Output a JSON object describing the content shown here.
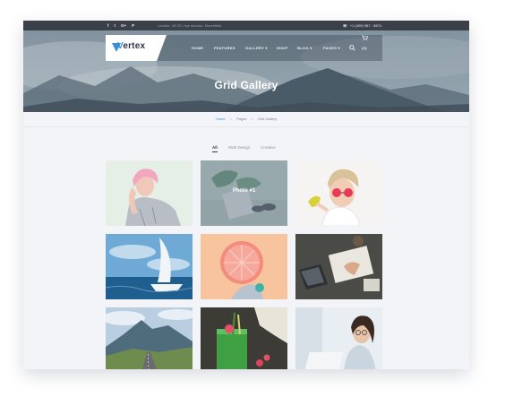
{
  "topbar": {
    "social": [
      "f",
      "t",
      "G+",
      "P"
    ],
    "address": "London, UK 53, Hye Avenue, Moorefield",
    "phone": "+1 (409) 987 - 5874"
  },
  "brand": {
    "logo_text": "ertex",
    "logo_mark": "V"
  },
  "nav": {
    "items": [
      "HOME",
      "FEATURES",
      "GALLERY",
      "SHOP",
      "BLOG",
      "PAGES"
    ],
    "cart": "(0)"
  },
  "hero": {
    "title": "Grid Gallery"
  },
  "breadcrumb": {
    "home": "Home",
    "sep": ">",
    "pages": "Pages",
    "current": "Grid Gallery"
  },
  "filters": [
    "All",
    "Web Design",
    "Creative"
  ],
  "gallery": {
    "hover_label": "Photo #1"
  },
  "colors": {
    "accent": "#3b8fd8",
    "topbar": "#3b3f47",
    "background": "#f3f4f8"
  }
}
